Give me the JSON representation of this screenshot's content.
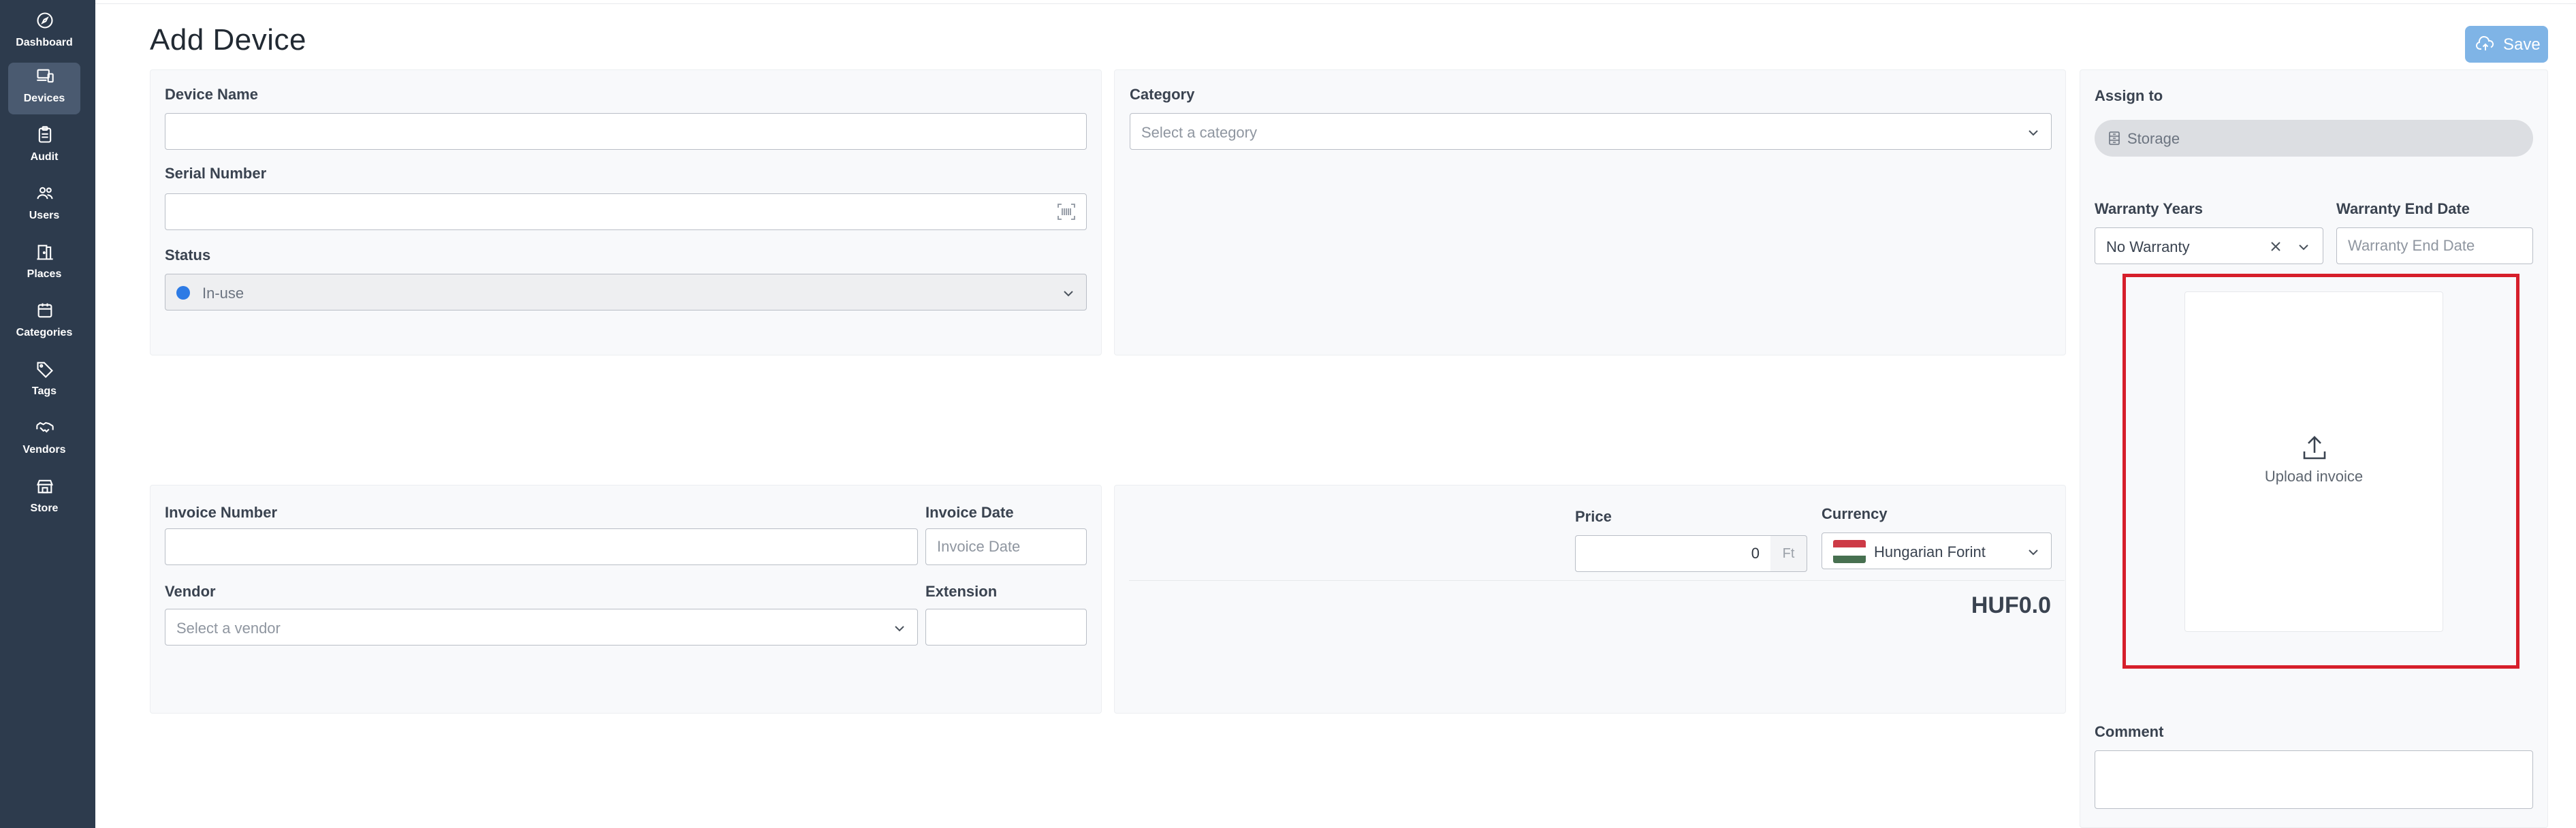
{
  "nav": {
    "items": [
      {
        "label": "Dashboard",
        "icon": "compass-icon"
      },
      {
        "label": "Devices",
        "icon": "devices-icon"
      },
      {
        "label": "Audit",
        "icon": "clipboard-icon"
      },
      {
        "label": "Users",
        "icon": "users-icon"
      },
      {
        "label": "Places",
        "icon": "door-icon"
      },
      {
        "label": "Categories",
        "icon": "calendar-icon"
      },
      {
        "label": "Tags",
        "icon": "tag-icon"
      },
      {
        "label": "Vendors",
        "icon": "handshake-icon"
      },
      {
        "label": "Store",
        "icon": "store-icon"
      }
    ],
    "active": "Devices"
  },
  "header": {
    "title": "Add Device",
    "save_label": "Save"
  },
  "details": {
    "device_name_label": "Device Name",
    "device_name_value": "",
    "serial_number_label": "Serial Number",
    "serial_number_value": "",
    "status_label": "Status",
    "status_value": "In-use",
    "status_color": "#2d7be5"
  },
  "category": {
    "label": "Category",
    "placeholder": "Select a category"
  },
  "assign": {
    "label": "Assign to",
    "value": "Storage"
  },
  "warranty": {
    "years_label": "Warranty Years",
    "years_value": "No Warranty",
    "end_date_label": "Warranty End Date",
    "end_date_placeholder": "Warranty End Date"
  },
  "upload": {
    "label": "Upload invoice",
    "highlight_color": "#d61f2b"
  },
  "comment": {
    "label": "Comment",
    "value": ""
  },
  "invoice": {
    "number_label": "Invoice Number",
    "number_value": "",
    "date_label": "Invoice Date",
    "date_placeholder": "Invoice Date",
    "vendor_label": "Vendor",
    "vendor_placeholder": "Select a vendor",
    "extension_label": "Extension",
    "extension_value": ""
  },
  "pricing": {
    "price_label": "Price",
    "price_value": "0",
    "price_suffix": "Ft",
    "currency_label": "Currency",
    "currency_value": "Hungarian Forint",
    "total": "HUF0.0"
  },
  "colors": {
    "sidebar": "#2d3b4d",
    "accent": "#7fb4e6"
  }
}
